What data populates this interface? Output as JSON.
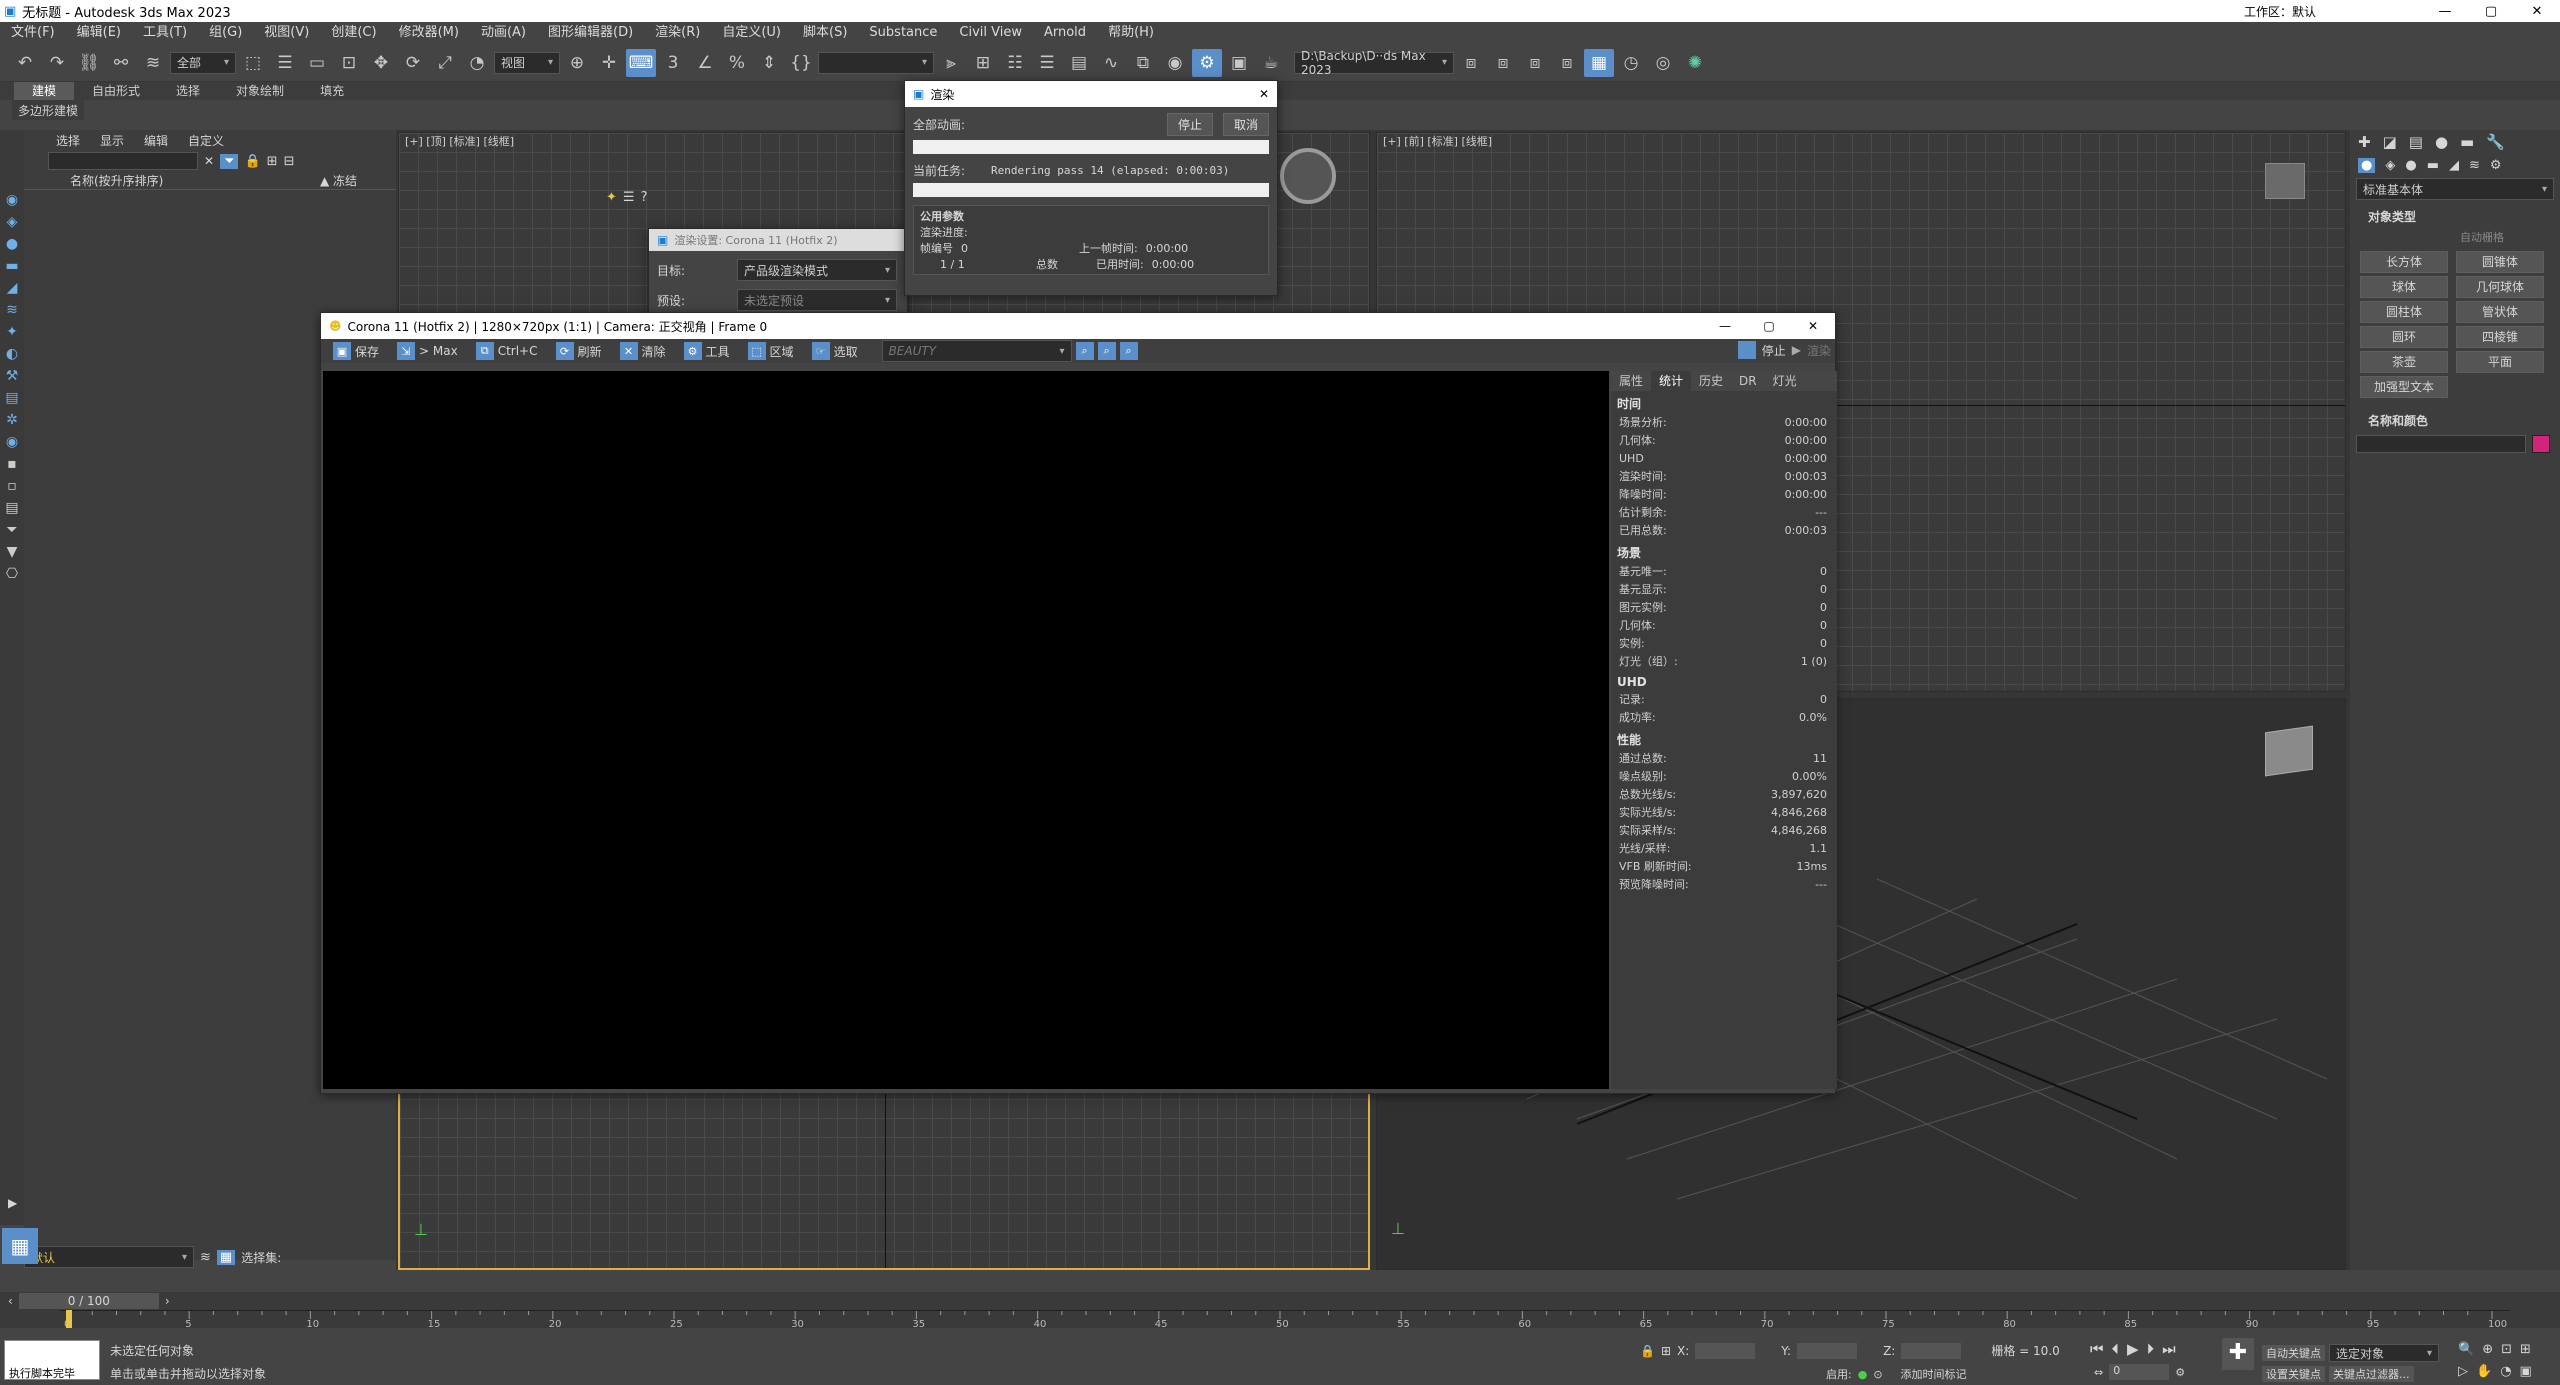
{
  "app": {
    "title": "无标题 - Autodesk 3ds Max 2023",
    "workspace_label": "工作区：",
    "workspace_value": "默认"
  },
  "menu": [
    "文件(F)",
    "编辑(E)",
    "工具(T)",
    "组(G)",
    "视图(V)",
    "创建(C)",
    "修改器(M)",
    "动画(A)",
    "图形编辑器(D)",
    "渲染(R)",
    "自定义(U)",
    "脚本(S)",
    "Substance",
    "Civil View",
    "Arnold",
    "帮助(H)"
  ],
  "toolbar": {
    "selection_filter": "全部",
    "ref_coord": "视图",
    "named_sel": "",
    "path": "D:\\Backup\\D··ds Max 2023"
  },
  "ribbon": {
    "tabs": [
      "建模",
      "自由形式",
      "选择",
      "对象绘制",
      "填充"
    ],
    "active": "建模",
    "sub": "多边形建模"
  },
  "scene_explorer": {
    "tabs": [
      "选择",
      "显示",
      "编辑",
      "自定义"
    ],
    "col_name": "名称(按升序排序)",
    "col_frozen": "▲ 冻结",
    "layer": "默认",
    "selection_set": "选择集:"
  },
  "viewports": {
    "top_left": "[+] [顶] [标准] [线框]",
    "top_right": "[+] [前] [标准] [线框]"
  },
  "render_progress": {
    "title": "渲染",
    "all_anim": "全部动画:",
    "stop": "停止",
    "cancel": "取消",
    "current_task_label": "当前任务:",
    "current_task": "Rendering pass 14 (elapsed: 0:00:03)",
    "section": "公用参数",
    "progress_label": "渲染进度:",
    "frame_no_label": "帧编号",
    "frame_no": "0",
    "frame_count": "1 / 1",
    "total": "总数",
    "last_frame_label": "上一帧时间:",
    "last_frame": "0:00:00",
    "used_label": "已用时间:",
    "used": "0:00:00"
  },
  "render_setup": {
    "title": "渲染设置: Corona 11 (Hotfix 2)",
    "target_label": "目标:",
    "target": "产品级渲染模式",
    "preset_label": "预设:",
    "preset": "未选定预设"
  },
  "vfb": {
    "title": "Corona 11 (Hotfix 2) | 1280×720px (1:1) | Camera: 正交视角 | Frame 0",
    "toolbar": [
      "保存",
      "> Max",
      "Ctrl+C",
      "刷新",
      "清除",
      "工具",
      "区域",
      "选取"
    ],
    "channel": "BEAUTY",
    "stop": "停止",
    "render": "渲染",
    "tabs": [
      "属性",
      "统计",
      "历史",
      "DR",
      "灯光"
    ],
    "active_tab": "统计",
    "sections": [
      {
        "title": "时间",
        "rows": [
          {
            "k": "场景分析:",
            "v": "0:00:00"
          },
          {
            "k": "几何体:",
            "v": "0:00:00"
          },
          {
            "k": "UHD",
            "v": "0:00:00"
          },
          {
            "k": "渲染时间:",
            "v": "0:00:03"
          },
          {
            "k": "降噪时间:",
            "v": "0:00:00"
          },
          {
            "k": "估计剩余:",
            "v": "---"
          },
          {
            "k": "已用总数:",
            "v": "0:00:03"
          }
        ]
      },
      {
        "title": "场景",
        "rows": [
          {
            "k": "基元唯一:",
            "v": "0"
          },
          {
            "k": "基元显示:",
            "v": "0"
          },
          {
            "k": "图元实例:",
            "v": "0"
          },
          {
            "k": "几何体:",
            "v": "0"
          },
          {
            "k": "实例:",
            "v": "0"
          },
          {
            "k": "灯光（组）:",
            "v": "1 (0)"
          }
        ]
      },
      {
        "title": "UHD",
        "rows": [
          {
            "k": "记录:",
            "v": "0"
          },
          {
            "k": "成功率:",
            "v": "0.0%"
          }
        ]
      },
      {
        "title": "性能",
        "rows": [
          {
            "k": "通过总数:",
            "v": "11"
          },
          {
            "k": "噪点级别:",
            "v": "0.00%"
          },
          {
            "k": "总数光线/s:",
            "v": "3,897,620"
          },
          {
            "k": "实际光线/s:",
            "v": "4,846,268"
          },
          {
            "k": "实际采样/s:",
            "v": "4,846,268"
          },
          {
            "k": "光线/采样:",
            "v": "1.1"
          },
          {
            "k": "VFB 刷新时间:",
            "v": "13ms"
          },
          {
            "k": "预览降噪时间:",
            "v": "---"
          }
        ]
      }
    ]
  },
  "command_panel": {
    "category": "标准基本体",
    "object_type": "对象类型",
    "auto_grid": "自动栅格",
    "buttons": [
      "长方体",
      "圆锥体",
      "球体",
      "几何球体",
      "圆柱体",
      "管状体",
      "圆环",
      "四棱锥",
      "茶壶",
      "平面",
      "加强型文本"
    ],
    "name_color": "名称和颜色"
  },
  "timeline": {
    "frame": "0 / 100",
    "ticks": [
      "0",
      "5",
      "10",
      "15",
      "20",
      "25",
      "30",
      "35",
      "40",
      "45",
      "50",
      "55",
      "60",
      "65",
      "70",
      "75",
      "80",
      "85",
      "90",
      "95",
      "100"
    ]
  },
  "status": {
    "script_label": "执行脚本完毕",
    "line1": "未选定任何对象",
    "line2": "单击或单击并拖动以选择对象",
    "x_label": "X:",
    "y_label": "Y:",
    "z_label": "Z:",
    "grid": "栅格 = 10.0",
    "enabled": "启用:",
    "add_time_tag": "添加时间标记",
    "auto_key": "自动关键点",
    "set_key": "设置关键点",
    "key_filter": "关键点过滤器...",
    "selected": "选定对象",
    "frame_field": "0"
  },
  "colors": {
    "accent": "#5b8fc9",
    "name_color_swatch": "#d0257a"
  }
}
